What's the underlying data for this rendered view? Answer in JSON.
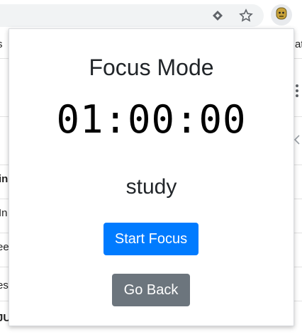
{
  "browser": {
    "toolbar_icons": [
      "extension-diamond-icon",
      "bookmark-star-icon",
      "extension-avatar-icon"
    ]
  },
  "background_page": {
    "fragments": [
      "s",
      "ato",
      "in",
      "In",
      "ee",
      "es",
      "JU"
    ]
  },
  "popup": {
    "title": "Focus Mode",
    "timer": "01:00:00",
    "mode_label": "study",
    "start_button": "Start Focus",
    "back_button": "Go Back"
  },
  "colors": {
    "primary": "#007bff",
    "secondary": "#6c757d"
  }
}
